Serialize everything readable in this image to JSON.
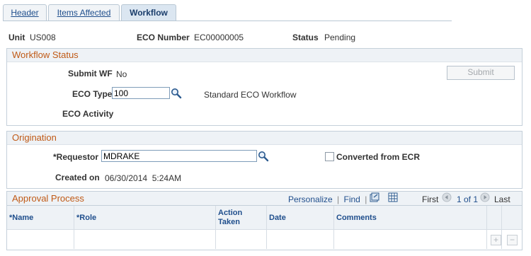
{
  "tabs": [
    {
      "label": "Header"
    },
    {
      "label": "Items Affected"
    },
    {
      "label": "Workflow"
    }
  ],
  "header_fields": {
    "unit_label": "Unit",
    "unit_value": "US008",
    "eco_number_label": "ECO Number",
    "eco_number_value": "EC00000005",
    "status_label": "Status",
    "status_value": "Pending"
  },
  "workflow_status": {
    "title": "Workflow Status",
    "submit_wf_label": "Submit WF",
    "submit_wf_value": "No",
    "submit_button": "Submit",
    "eco_type_label": "ECO Type",
    "eco_type_value": "100",
    "eco_type_description": "Standard ECO Workflow",
    "eco_activity_label": "ECO Activity"
  },
  "origination": {
    "title": "Origination",
    "requestor_label": "*Requestor",
    "requestor_value": "MDRAKE",
    "converted_label": "Converted from ECR",
    "converted_checked": false,
    "created_on_label": "Created on",
    "created_on_value": "06/30/2014  5:24AM"
  },
  "approval_process": {
    "title": "Approval Process",
    "personalize": "Personalize",
    "find": "Find",
    "separator": "|",
    "first": "First",
    "range": "1 of 1",
    "last": "Last",
    "columns": [
      "*Name",
      "*Role",
      "Action Taken",
      "Date",
      "Comments"
    ],
    "add_symbol": "+",
    "remove_symbol": "−"
  },
  "colors": {
    "section_title": "#c05a16",
    "link": "#1f4e8c",
    "border": "#c5d0da"
  }
}
